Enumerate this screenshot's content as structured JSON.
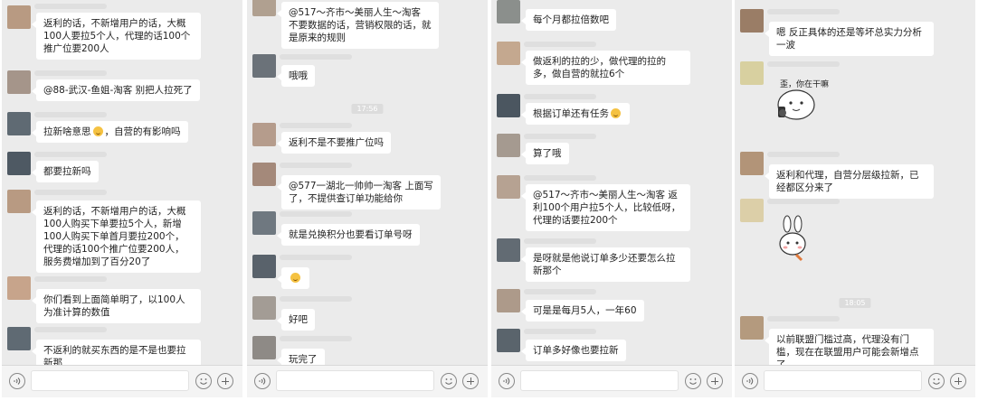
{
  "colors": {
    "panel_bg": "#ebebeb",
    "bubble_bg": "#ffffff",
    "input_bg": "#f4f4f4"
  },
  "panels": [
    {
      "messages": [
        {
          "type": "msg",
          "text": "返利的话，不新增用户的话，大概100人要拉5个人，代理的话100个推广位要200人",
          "avatar": "#b89a82"
        },
        {
          "type": "msg",
          "text": "@88-武汉-鱼姐-淘客 别把人拉死了",
          "avatar": "#a5958a"
        },
        {
          "type": "msg",
          "text": "拉新啥意思",
          "suffix": "，自营的有影响吗",
          "emoji": "grin-emoji",
          "avatar": "#5f6a73"
        },
        {
          "type": "msg",
          "text": "都要拉新吗",
          "avatar": "#4e5963"
        },
        {
          "type": "msg",
          "text": "返利的话，不新增用户的话，大概100人购买下单要拉5个人，新增100人购买下单首月要拉200个，代理的话100个推广位要200人，服务费增加到了百分20了",
          "avatar": "#b89a82"
        },
        {
          "type": "msg",
          "text": "你们看到上面简单明了，以100人为准计算的数值",
          "avatar": "#c7a48b"
        },
        {
          "type": "msg",
          "text": "不返利的就买东西的是不是也要拉新那",
          "avatar": "#5f6a73"
        }
      ]
    },
    {
      "messages": [
        {
          "type": "msg",
          "text": "@517～齐市～美丽人生～淘客 不要数据的话，营销权限的话，就是原来的规则",
          "avatar": "#b0a090"
        },
        {
          "type": "msg",
          "text": "哦哦",
          "avatar": "#6b7279"
        },
        {
          "type": "time",
          "text": "17:56"
        },
        {
          "type": "msg",
          "text": "返利不是不要推广位吗",
          "avatar": "#b59c8c"
        },
        {
          "type": "msg",
          "text": "@577一湖北一帅帅一淘客 上面写了，不提供查订单功能给你",
          "avatar": "#a4897a"
        },
        {
          "type": "msg",
          "text": "就是兑换积分也要看订单号呀",
          "avatar": "#6f7880"
        },
        {
          "type": "msg",
          "text": "",
          "emoji": "sad-emoji",
          "avatar": "#59626b"
        },
        {
          "type": "msg",
          "text": "好吧",
          "avatar": "#a39c95"
        },
        {
          "type": "msg",
          "text": "玩完了",
          "avatar": "#8e8a86"
        }
      ]
    },
    {
      "messages": [
        {
          "type": "msg",
          "text": "每个月都拉倍数吧",
          "avatar": "#8b8f8c"
        },
        {
          "type": "msg",
          "text": "做返利的拉的少，做代理的拉的多，做自营的就拉6个",
          "avatar": "#c4a88f"
        },
        {
          "type": "msg",
          "text": "根据订单还有任务",
          "emoji": "smile-emoji",
          "avatar": "#4b5660"
        },
        {
          "type": "msg",
          "text": "算了哦",
          "avatar": "#a59a90"
        },
        {
          "type": "msg",
          "text": "@517～齐市～美丽人生～淘客 返利100个用户拉5个人，比较低呀，代理的话要拉200个",
          "avatar": "#b6a292"
        },
        {
          "type": "msg",
          "text": "是呀就是他说订单多少还要怎么拉新那个",
          "avatar": "#626b73"
        },
        {
          "type": "msg",
          "text": "可是是每月5人，一年60",
          "avatar": "#ad9a8a"
        },
        {
          "type": "msg",
          "text": "订单多好像也要拉新",
          "avatar": "#5a646c"
        }
      ]
    },
    {
      "messages": [
        {
          "type": "msg",
          "text": "嗯 反正具体的还是等坏总实力分析一波",
          "avatar": "#9a7d66"
        },
        {
          "type": "sticker",
          "text": "歪，你在干嘛",
          "name": "phone-call-sticker",
          "avatar": "#d8d0a0"
        },
        {
          "type": "msg",
          "text": "返利和代理，自营分层级拉新，已经都区分来了",
          "avatar": "#b29478"
        },
        {
          "type": "sticker",
          "text": "",
          "name": "bunny-sticker",
          "avatar": "#dccfa8"
        },
        {
          "type": "time",
          "text": "18:05"
        },
        {
          "type": "msg",
          "text": "以前联盟门槛过高，代理没有门槛，现在在联盟用户可能会新增点了",
          "avatar": "#b49a7e"
        }
      ]
    }
  ]
}
